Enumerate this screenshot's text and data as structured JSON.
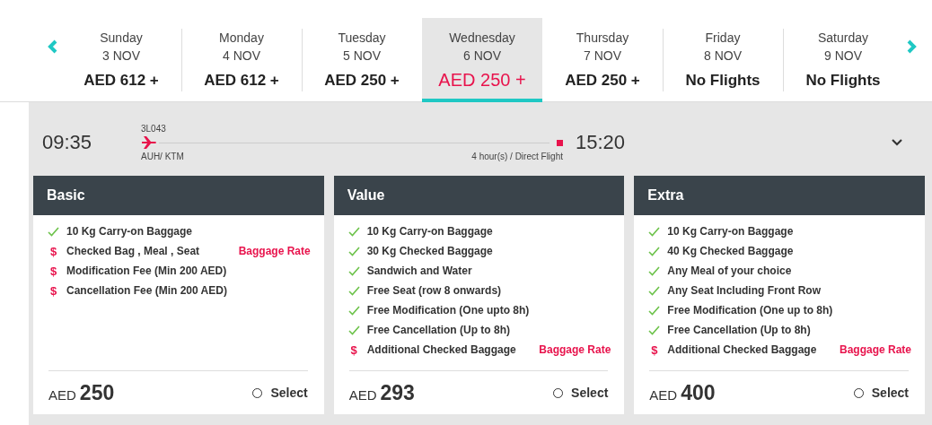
{
  "days": [
    {
      "weekday": "Sunday",
      "date": "3 NOV",
      "price": "AED 612 +",
      "selected": false
    },
    {
      "weekday": "Monday",
      "date": "4 NOV",
      "price": "AED 612 +",
      "selected": false
    },
    {
      "weekday": "Tuesday",
      "date": "5 NOV",
      "price": "AED 250 +",
      "selected": false
    },
    {
      "weekday": "Wednesday",
      "date": "6 NOV",
      "price": "AED 250 +",
      "selected": true
    },
    {
      "weekday": "Thursday",
      "date": "7 NOV",
      "price": "AED 250 +",
      "selected": false
    },
    {
      "weekday": "Friday",
      "date": "8 NOV",
      "price": "No Flights",
      "selected": false
    },
    {
      "weekday": "Saturday",
      "date": "9 NOV",
      "price": "No Flights",
      "selected": false
    }
  ],
  "flight": {
    "departure": "09:35",
    "arrival": "15:20",
    "number": "3L043",
    "route": "AUH/ KTM",
    "duration": "4 hour(s) / Direct Flight",
    "expanded": false
  },
  "fares": [
    {
      "name": "Basic",
      "currency": "AED",
      "price": "250",
      "selected": false,
      "select_label": "Select",
      "features": [
        {
          "kind": "included",
          "text": "10 Kg Carry-on Baggage"
        },
        {
          "kind": "paid",
          "mark": "$",
          "text": "Checked Bag , Meal , Seat",
          "link": "Baggage Rate"
        },
        {
          "kind": "paid",
          "mark": "$",
          "text": "Modification Fee (Min 200 AED)"
        },
        {
          "kind": "paid",
          "mark": "$",
          "text": "Cancellation Fee (Min 200 AED)"
        }
      ]
    },
    {
      "name": "Value",
      "currency": "AED",
      "price": "293",
      "selected": false,
      "select_label": "Select",
      "features": [
        {
          "kind": "included",
          "text": "10 Kg Carry-on Baggage"
        },
        {
          "kind": "included",
          "text": "30 Kg Checked Baggage"
        },
        {
          "kind": "included",
          "text": "Sandwich and Water"
        },
        {
          "kind": "included",
          "text": "Free Seat (row 8 onwards)"
        },
        {
          "kind": "included",
          "text": "Free Modification (One upto 8h)"
        },
        {
          "kind": "included",
          "text": "Free Cancellation (Up to 8h)"
        },
        {
          "kind": "paid",
          "mark": "$",
          "text": "Additional Checked Baggage",
          "link": "Baggage Rate"
        }
      ]
    },
    {
      "name": "Extra",
      "currency": "AED",
      "price": "400",
      "selected": false,
      "select_label": "Select",
      "features": [
        {
          "kind": "included",
          "text": "10 Kg Carry-on Baggage"
        },
        {
          "kind": "included",
          "text": "40 Kg Checked Baggage"
        },
        {
          "kind": "included",
          "text": "Any Meal of your choice"
        },
        {
          "kind": "included",
          "text": "Any Seat Including Front Row"
        },
        {
          "kind": "included",
          "text": "Free Modification (One up to 8h)"
        },
        {
          "kind": "included",
          "text": "Free Cancellation (Up to 8h)"
        },
        {
          "kind": "paid",
          "mark": "$",
          "text": "Additional Checked Baggage",
          "link": "Baggage Rate"
        }
      ]
    }
  ]
}
